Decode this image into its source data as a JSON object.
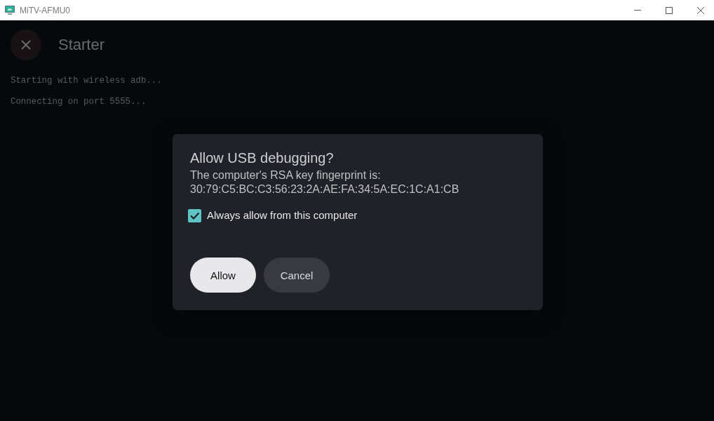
{
  "window": {
    "title": "MiTV-AFMU0"
  },
  "header": {
    "title": "Starter"
  },
  "log": [
    "Starting with wireless adb...",
    "Connecting on port 5555..."
  ],
  "dialog": {
    "title": "Allow USB debugging?",
    "message": "The computer's RSA key fingerprint is:",
    "fingerprint": "30:79:C5:BC:C3:56:23:2A:AE:FA:34:5A:EC:1C:A1:CB",
    "checkbox": {
      "label": "Always allow from this computer",
      "checked": true
    },
    "buttons": [
      {
        "label": "Allow",
        "focused": true
      },
      {
        "label": "Cancel",
        "focused": false
      }
    ]
  }
}
